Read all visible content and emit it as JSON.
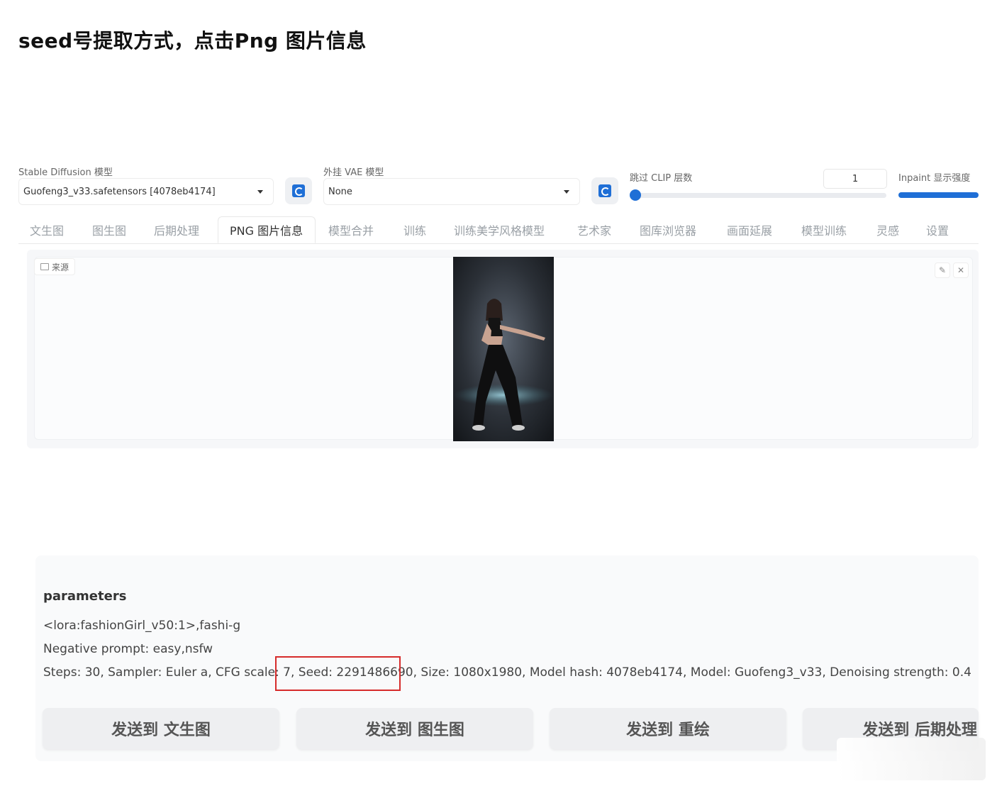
{
  "heading": "seed号提取方式，点击Png 图片信息",
  "settings": {
    "sd_model_label": "Stable Diffusion 模型",
    "sd_model_value": "Guofeng3_v33.safetensors [4078eb4174]",
    "vae_label": "外挂 VAE 模型",
    "vae_value": "None",
    "clip_label": "跳过 CLIP 层数",
    "clip_value": "1",
    "inpaint_label": "Inpaint 显示强度"
  },
  "tabs": [
    "文生图",
    "图生图",
    "后期处理",
    "PNG 图片信息",
    "模型合并",
    "训练",
    "训练美学风格模型",
    "艺术家",
    "图库浏览器",
    "画面延展",
    "模型训练",
    "灵感",
    "设置"
  ],
  "active_tab": "PNG 图片信息",
  "image_panel": {
    "source_label": "来源",
    "edit_icon": "✎",
    "close_icon": "✕"
  },
  "params": {
    "title": "parameters",
    "line1": "<lora:fashionGirl_v50:1>,fashi-g",
    "line2": "Negative prompt: easy,nsfw",
    "line3": "Steps: 30, Sampler: Euler a, CFG scale: 7, Seed: 2291486690, Size: 1080x1980, Model hash: 4078eb4174, Model: Guofeng3_v33, Denoising strength: 0.4"
  },
  "buttons": {
    "send_txt2img": "发送到 文生图",
    "send_img2img": "发送到 图生图",
    "send_inpaint": "发送到 重绘",
    "send_extras": "发送到 后期处理"
  },
  "colors": {
    "accent": "#1f6fd6",
    "highlight": "#d62b2b"
  }
}
